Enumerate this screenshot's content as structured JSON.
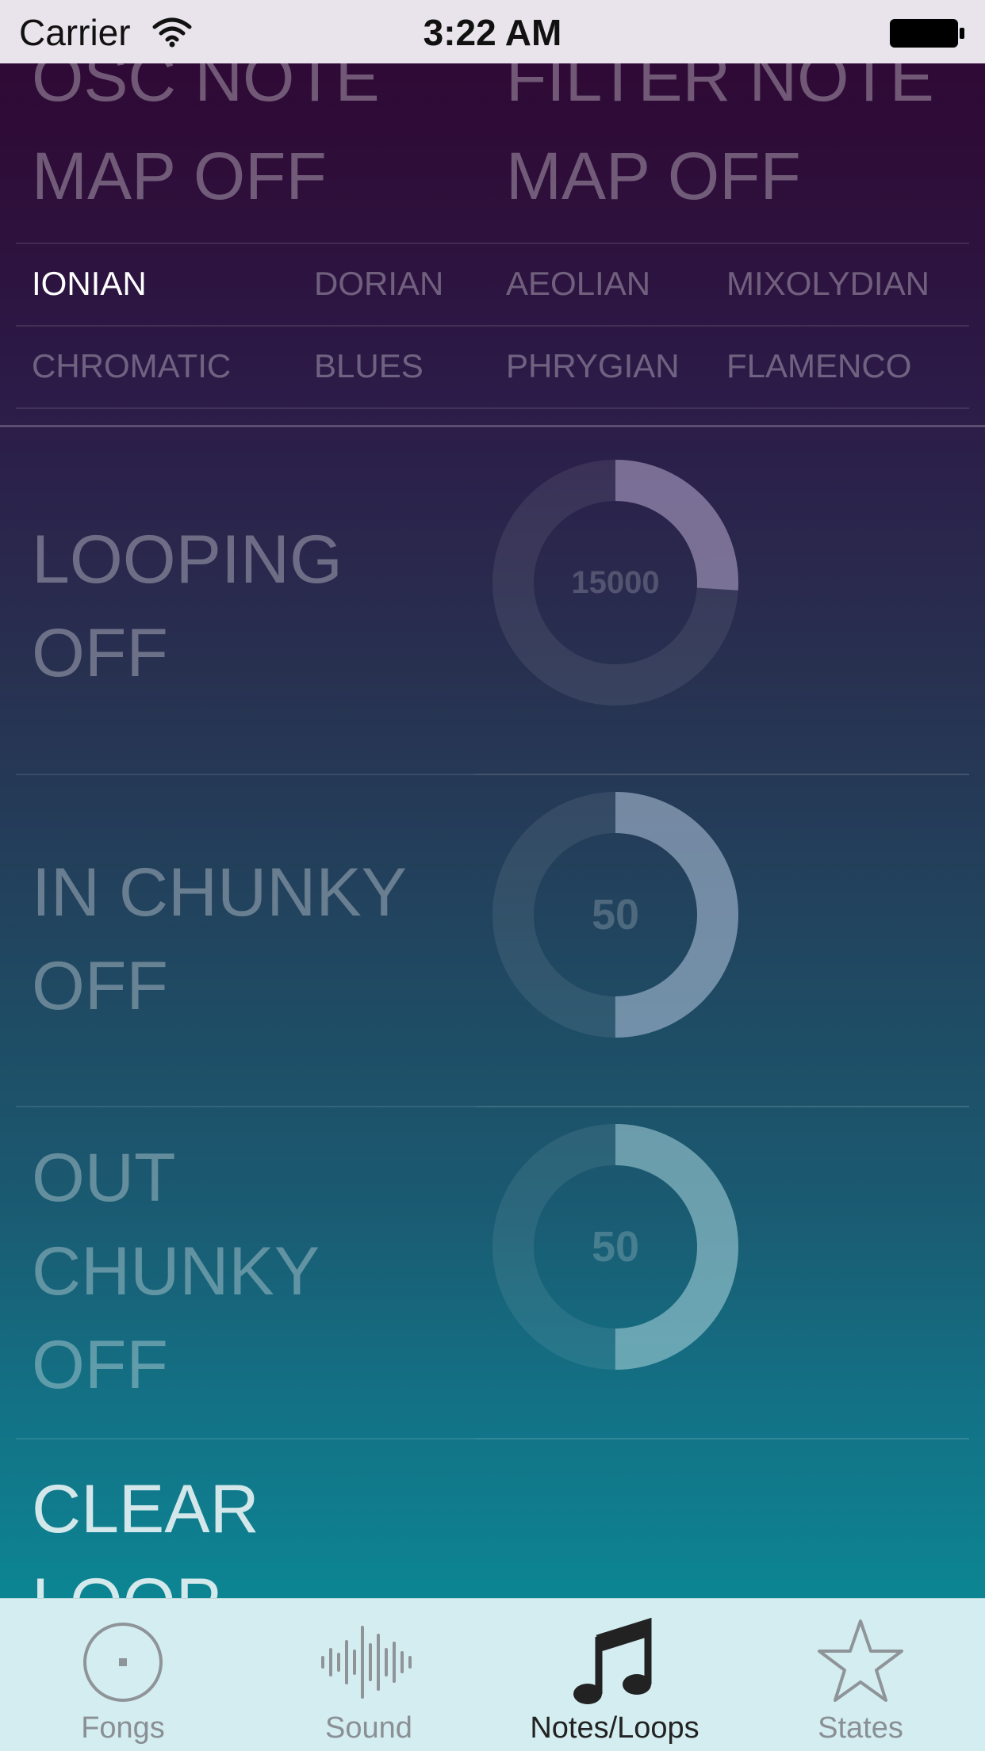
{
  "status_bar": {
    "carrier": "Carrier",
    "time": "3:22 AM"
  },
  "note_map": {
    "osc": {
      "line1": "OSC NOTE",
      "line2": "MAP OFF"
    },
    "filter": {
      "line1": "FILTER NOTE",
      "line2": "MAP OFF"
    }
  },
  "scales": {
    "row1": [
      "IONIAN",
      "DORIAN",
      "AEOLIAN",
      "MIXOLYDIAN"
    ],
    "row2": [
      "CHROMATIC",
      "BLUES",
      "PHRYGIAN",
      "FLAMENCO"
    ],
    "active": "IONIAN"
  },
  "controls": {
    "looping": {
      "line1": "LOOPING",
      "line2": "OFF",
      "value": "15000",
      "fill_fraction": 0.26
    },
    "in_chunky": {
      "line1": "IN CHUNKY",
      "line2": "OFF",
      "value": "50",
      "fill_fraction": 0.5
    },
    "out_chunky": {
      "line1": "OUT",
      "line2": "CHUNKY",
      "line3": "OFF",
      "value": "50",
      "fill_fraction": 0.5
    },
    "clear_loop": {
      "line1": "CLEAR",
      "line2": "LOOP"
    }
  },
  "tab_bar": {
    "tabs": [
      {
        "label": "Fongs",
        "icon": "disc-icon"
      },
      {
        "label": "Sound",
        "icon": "waveform-icon"
      },
      {
        "label": "Notes/Loops",
        "icon": "music-note-icon"
      },
      {
        "label": "States",
        "icon": "star-icon"
      }
    ],
    "selected_index": 2
  },
  "colors": {
    "knob_fill_top": "#8f7fa8",
    "knob_fill_mid": "#7e94ad",
    "knob_fill_low": "#6fa6b4"
  }
}
